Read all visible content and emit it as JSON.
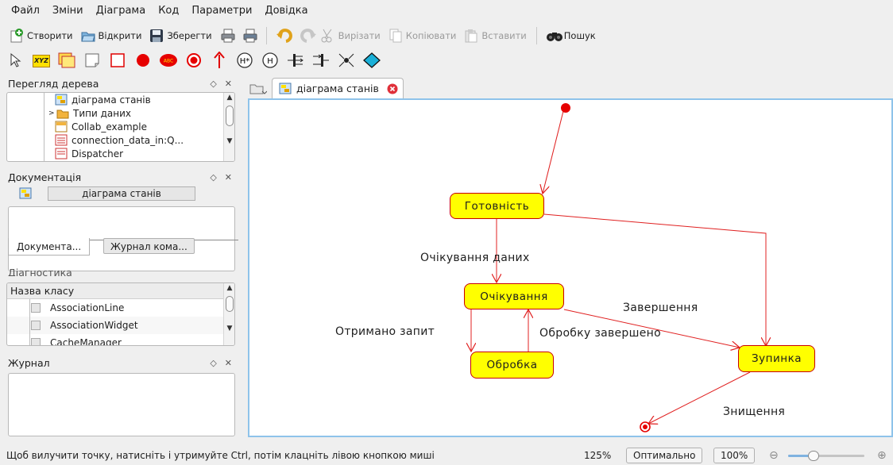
{
  "menu": [
    "Файл",
    "Зміни",
    "Діаграма",
    "Код",
    "Параметри",
    "Довідка"
  ],
  "toolbar": {
    "new": "Створити",
    "open": "Відкрити",
    "save": "Зберегти",
    "cut": "Вирізати",
    "copy": "Копіювати",
    "paste": "Вставити",
    "find": "Пошук"
  },
  "palette": {
    "class_label": "XYZ",
    "object_label": "ABC",
    "history_deep": "H*",
    "history_shallow": "H"
  },
  "tree_panel": {
    "title": "Перегляд дерева",
    "items": [
      "діаграма станів",
      "Типи даних",
      "Collab_example",
      "connection_data_in:Q...",
      "Dispatcher"
    ]
  },
  "doc_panel": {
    "title": "Документація",
    "diagram_name": "діаграма станів",
    "tab_doc": "Документа...",
    "tab_log": "Журнал кома..."
  },
  "diag_panel": {
    "title": "Діагностика",
    "column": "Назва класу",
    "items": [
      "AssociationLine",
      "AssociationWidget",
      "CacheManager"
    ]
  },
  "log_panel": {
    "title": "Журнал"
  },
  "editor": {
    "tab_label": "діаграма станів"
  },
  "diagram": {
    "states": {
      "ready": "Готовність",
      "waiting": "Очікування",
      "processing": "Обробка",
      "stop": "Зупинка"
    },
    "transitions": {
      "wait_data": "Очікування даних",
      "request_received": "Отримано запит",
      "processing_done": "Обробку завершено",
      "finish": "Завершення",
      "destroy": "Знищення"
    },
    "colors": {
      "state_fill": "#ffff00",
      "line": "#e02020",
      "initial": "#e60000"
    }
  },
  "status": {
    "hint": "Щоб вилучити точку, натисніть і утримуйте Ctrl, потім клацніть лівою кнопкою миші",
    "zoom": "125%",
    "fit": "Оптимально",
    "actual": "100%",
    "zoom_level": 0.3
  }
}
